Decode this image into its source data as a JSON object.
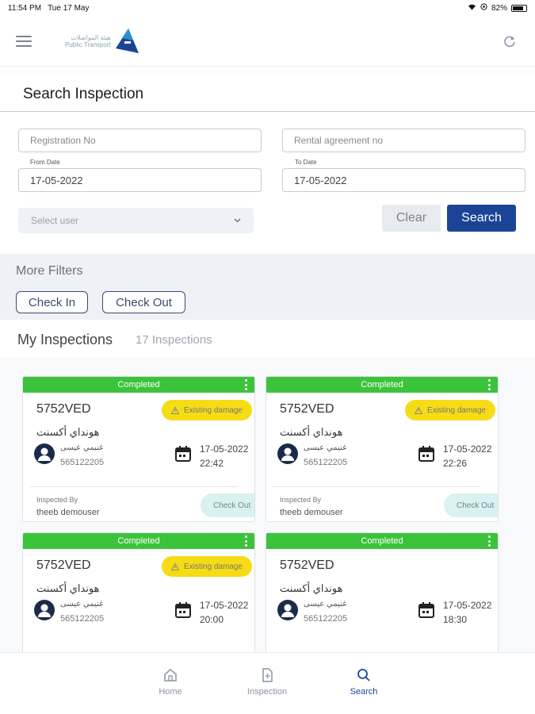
{
  "status_bar": {
    "time": "11:54 PM",
    "date": "Tue 17 May",
    "battery": "82%",
    "battery_level": 0.82
  },
  "app_bar": {
    "logo_text_line1": "هيئة المواصلات",
    "logo_text_line2": "Public Transport"
  },
  "search": {
    "title": "Search Inspection",
    "registration_placeholder": "Registration No",
    "rental_placeholder": "Rental agreement no",
    "from_label": "From Date",
    "from_value": "17-05-2022",
    "to_label": "To Date",
    "to_value": "17-05-2022",
    "user_placeholder": "Select user",
    "clear_label": "Clear",
    "search_label": "Search"
  },
  "more_filters": {
    "title": "More Filters",
    "check_in": "Check In",
    "check_out": "Check Out"
  },
  "inspections": {
    "title": "My Inspections",
    "count": "17 Inspections",
    "cards": [
      {
        "status": "Completed",
        "reg_no": "5752VED",
        "badge": "Existing damage",
        "car_name": "هونداي أكسنت",
        "customer_name": "غنيمي عيسى",
        "customer_phone": "565122205",
        "date": "17-05-2022",
        "time": "22:42",
        "inspected_by_label": "Inspected By",
        "inspected_by": "theeb demouser",
        "action": "Check Out"
      },
      {
        "status": "Completed",
        "reg_no": "5752VED",
        "badge": "Existing damage",
        "car_name": "هونداي أكسنت",
        "customer_name": "غنيمي عيسى",
        "customer_phone": "565122205",
        "date": "17-05-2022",
        "time": "22:26",
        "inspected_by_label": "Inspected By",
        "inspected_by": "theeb demouser",
        "action": "Check Out"
      },
      {
        "status": "Completed",
        "reg_no": "5752VED",
        "badge": "Existing damage",
        "car_name": "هونداي أكسنت",
        "customer_name": "غنيمي عيسى",
        "customer_phone": "565122205",
        "date": "17-05-2022",
        "time": "20:00"
      },
      {
        "status": "Completed",
        "reg_no": "5752VED",
        "car_name": "هونداي أكسنت",
        "customer_name": "غنيمي عيسى",
        "customer_phone": "565122205",
        "date": "17-05-2022",
        "time": "18:30"
      }
    ]
  },
  "bottom_nav": {
    "home": "Home",
    "inspection": "Inspection",
    "search": "Search"
  },
  "colors": {
    "primary": "#1c4496",
    "completed": "#3cc33c",
    "badge": "#f5dc15",
    "filters_bg": "#eef1f6"
  }
}
